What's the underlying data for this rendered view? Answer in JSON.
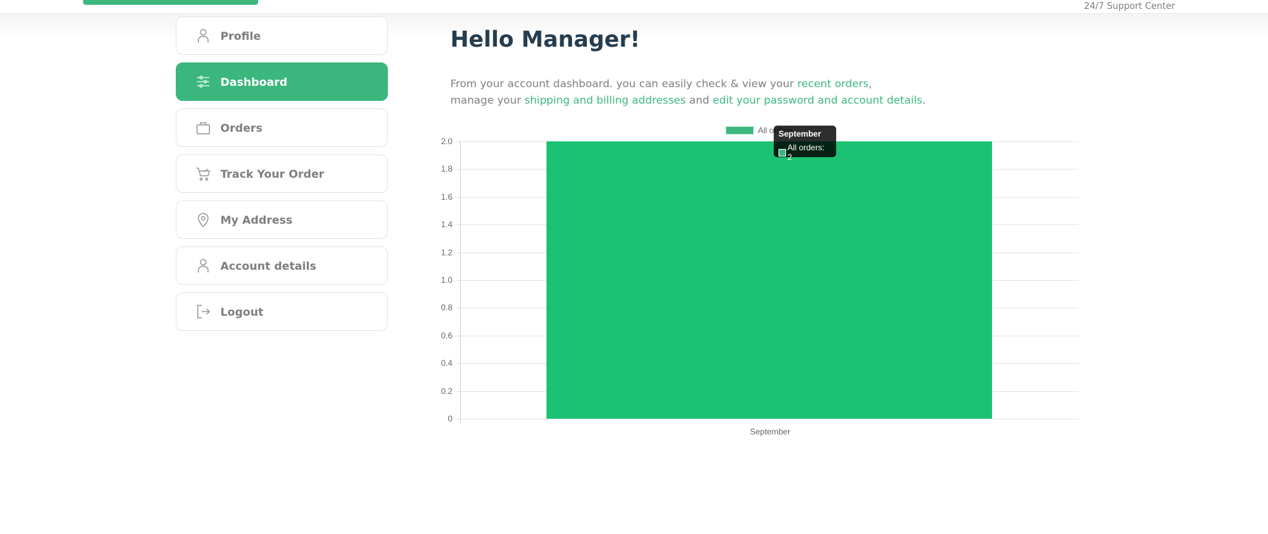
{
  "header": {
    "support": "24/7 Support Center"
  },
  "sidebar": {
    "items": [
      {
        "label": "Profile",
        "icon": "user-icon"
      },
      {
        "label": "Dashboard",
        "icon": "sliders-icon",
        "active": true
      },
      {
        "label": "Orders",
        "icon": "bag-icon"
      },
      {
        "label": "Track Your Order",
        "icon": "cart-check-icon"
      },
      {
        "label": "My Address",
        "icon": "map-pin-icon"
      },
      {
        "label": "Account details",
        "icon": "user-icon"
      },
      {
        "label": "Logout",
        "icon": "logout-icon"
      }
    ]
  },
  "main": {
    "title": "Hello Manager!",
    "intro": {
      "t1": "From your account dashboard. you can easily check & view your ",
      "l1": "recent orders",
      "t2": ",",
      "t3": "manage your ",
      "l2": "shipping and billing addresses",
      "t4": " and ",
      "l3": "edit your password and account details",
      "t5": "."
    }
  },
  "chart_data": {
    "type": "bar",
    "categories": [
      "September"
    ],
    "series": [
      {
        "name": "All orders",
        "values": [
          2
        ],
        "color": "#1bc273"
      }
    ],
    "ylim": [
      0,
      2
    ],
    "yticks": [
      "0",
      "0.2",
      "0.4",
      "0.6",
      "0.8",
      "1.0",
      "1.2",
      "1.4",
      "1.6",
      "1.8",
      "2.0"
    ],
    "legend": "top",
    "tooltip": {
      "title": "September",
      "label": "All orders: 2"
    }
  }
}
